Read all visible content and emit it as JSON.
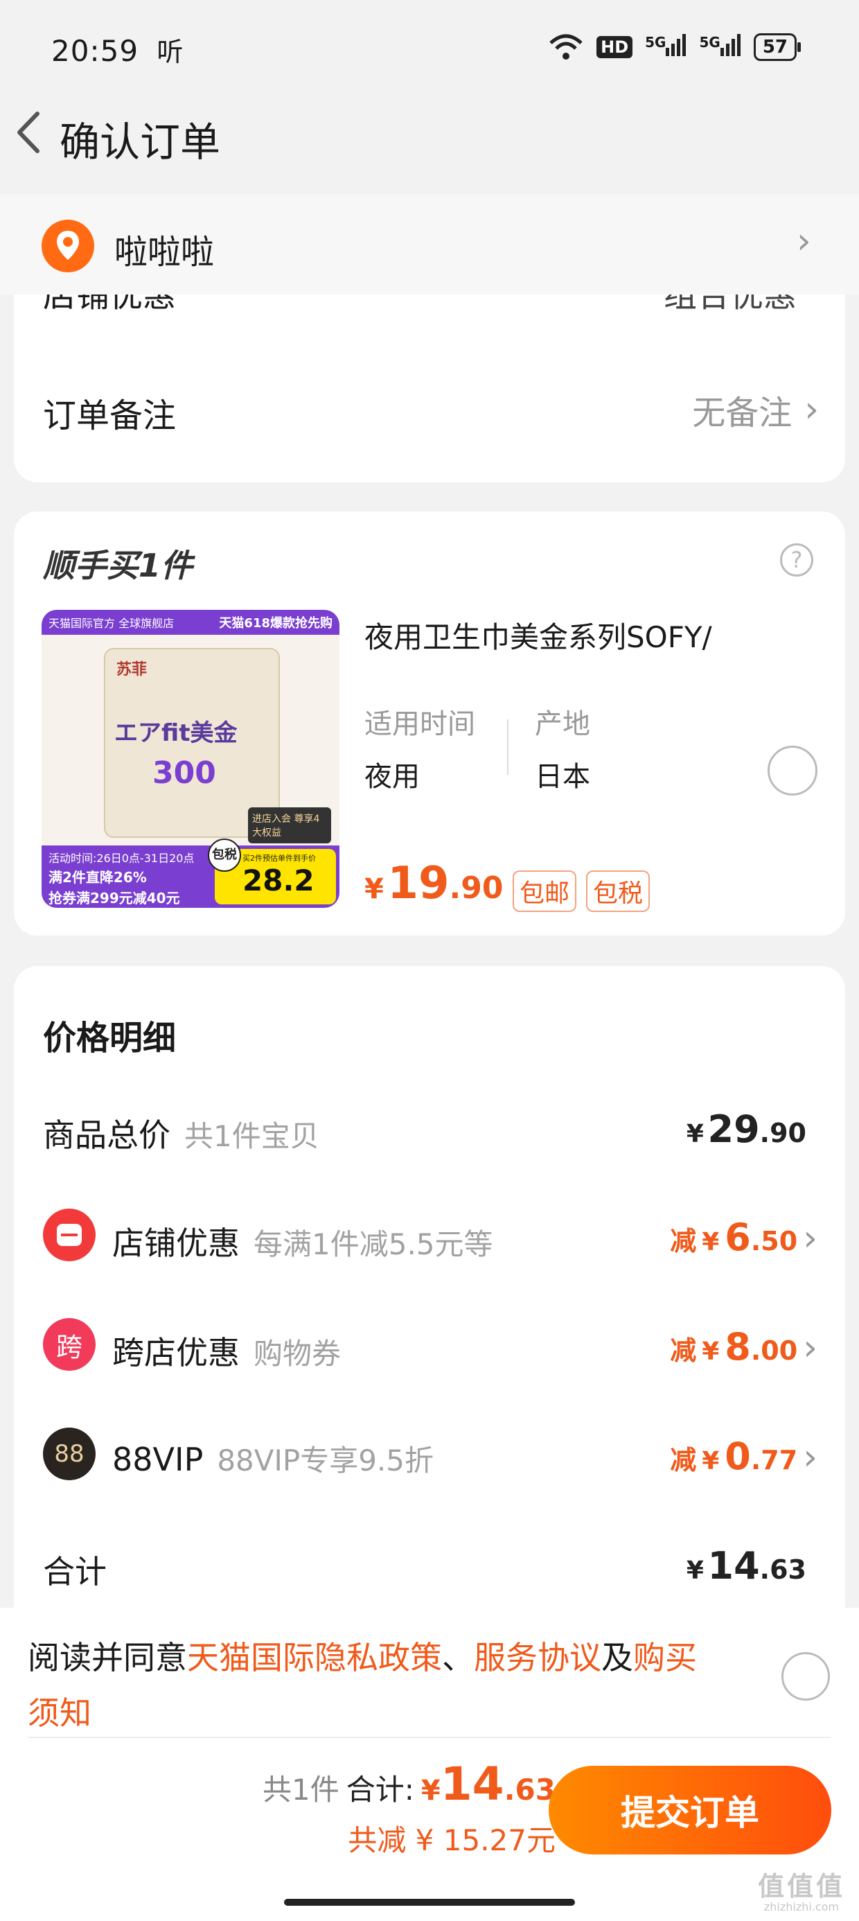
{
  "status_bar": {
    "time": "20:59",
    "time_suffix": "听",
    "hd": "HD",
    "net1": "5G",
    "net2": "5G",
    "battery": "57"
  },
  "header": {
    "title": "确认订单"
  },
  "address": {
    "name": "啦啦啦"
  },
  "partial_row": {
    "label": "店铺优惠",
    "value": "组合优惠"
  },
  "remark": {
    "label": "订单备注",
    "value": "无备注"
  },
  "add_on": {
    "title": "顺手买1件",
    "product_title": "夜用卫生巾美金系列SOFY/",
    "attr1_label": "适用时间",
    "attr1_value": "夜用",
    "attr2_label": "产地",
    "attr2_value": "日本",
    "price_symbol": "¥",
    "price_int": "19",
    "price_dec": ".90",
    "tags": [
      "包邮",
      "包税"
    ],
    "img": {
      "banner_left": "天猫国际官方 全球旗舰店",
      "banner_right": "天猫618爆款抢先购",
      "brand": "苏菲",
      "product_name": "エアfit美金",
      "num": "300",
      "promo1": "活动时间:26日0点-31日20点",
      "promo2": "满2件直降26%",
      "promo3": "抢券满299元减40元",
      "badge": "包税",
      "badge_note": "买2件预估单件到手价",
      "img_price": "28.2",
      "gift": "进店入会 尊享4大权益"
    }
  },
  "price_detail": {
    "title": "价格明细",
    "rows": [
      {
        "label": "商品总价",
        "sub": "共1件宝贝",
        "prefix": "",
        "sym": "¥",
        "int": "29",
        "dec": ".90"
      },
      {
        "icon": "店",
        "label": "店铺优惠",
        "sub": "每满1件减5.5元等",
        "prefix": "减",
        "sym": "¥",
        "int": "6",
        "dec": ".50"
      },
      {
        "icon": "跨",
        "label": "跨店优惠",
        "sub": "购物券",
        "prefix": "减",
        "sym": "¥",
        "int": "8",
        "dec": ".00"
      },
      {
        "icon": "88",
        "label": "88VIP",
        "sub": "88VIP专享9.5折",
        "prefix": "减",
        "sym": "¥",
        "int": "0",
        "dec": ".77"
      }
    ],
    "total_label": "合计",
    "total_sym": "¥",
    "total_int": "14",
    "total_dec": ".63"
  },
  "agreement": {
    "prefix": "阅读并同意",
    "link1": "天猫国际隐私政策",
    "sep1": "、",
    "link2": "服务协议",
    "sep2": "及",
    "link3a": "购买",
    "link3b": "须知"
  },
  "footer": {
    "count": "共1件",
    "total_label": "合计:",
    "sym": "¥",
    "int": "14",
    "dec": ".63",
    "saved": "共减 ¥ 15.27元",
    "submit": "提交订单"
  },
  "watermark": {
    "logo": "值值值",
    "url": "zhizhizhi.com"
  },
  "colors": {
    "accent": "#f05a1a",
    "submit_start": "#ff8a00",
    "submit_end": "#ff4d0d"
  }
}
